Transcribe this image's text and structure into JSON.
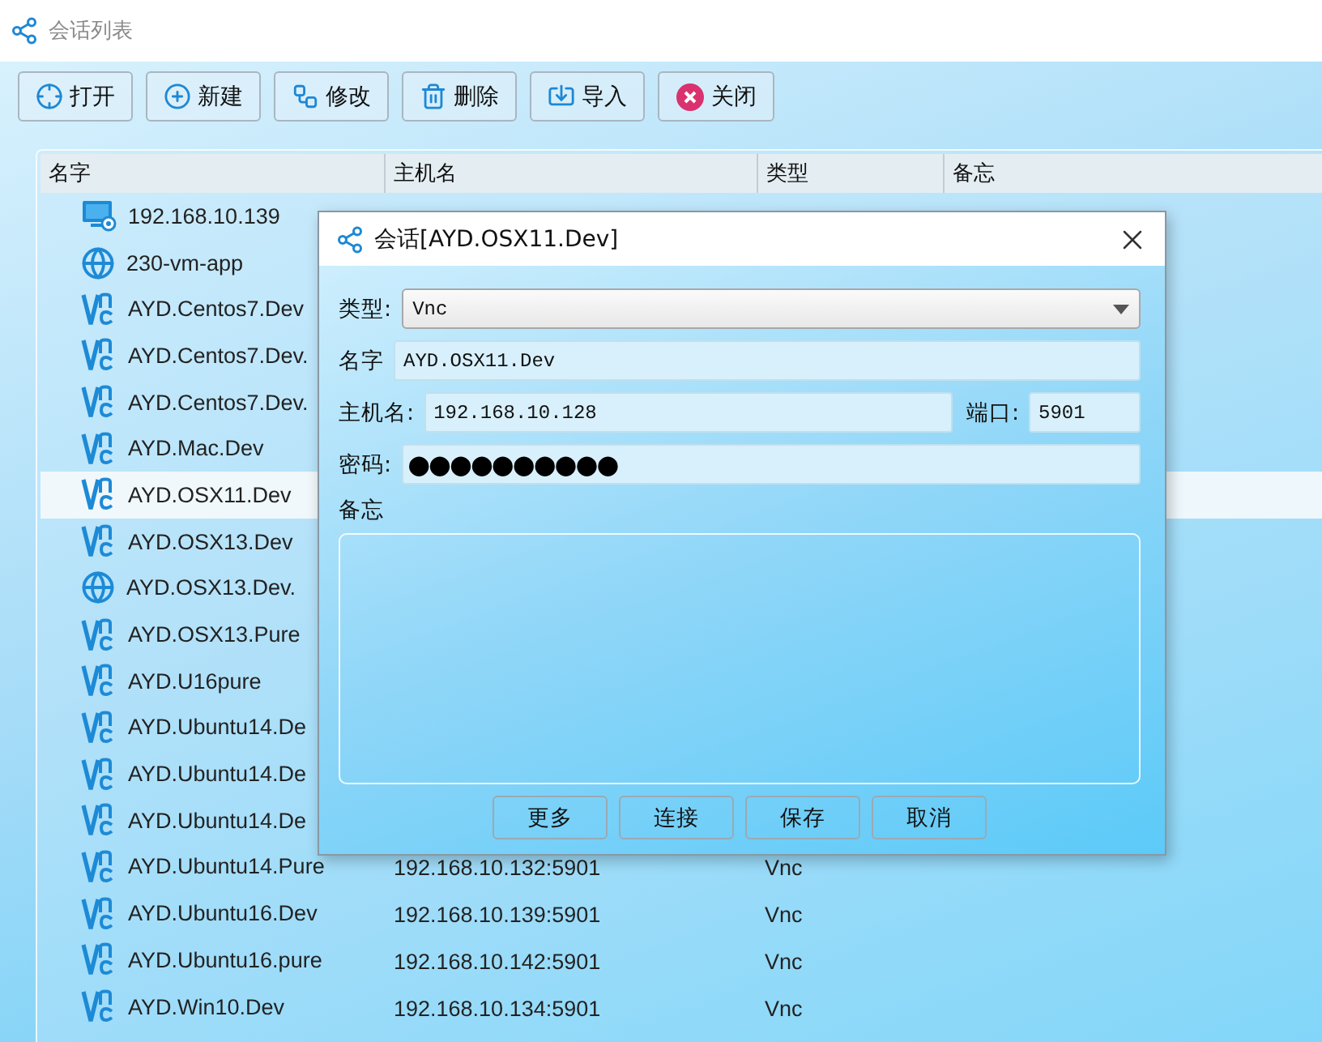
{
  "window": {
    "title": "会话列表"
  },
  "toolbar": [
    {
      "kind": "open",
      "label": "打开"
    },
    {
      "kind": "new",
      "label": "新建"
    },
    {
      "kind": "edit",
      "label": "修改"
    },
    {
      "kind": "delete",
      "label": "删除"
    },
    {
      "kind": "import",
      "label": "导入"
    },
    {
      "kind": "close",
      "label": "关闭"
    }
  ],
  "table": {
    "columns": [
      "名字",
      "主机名",
      "类型",
      "备忘"
    ],
    "rows": [
      {
        "kind": "monitor",
        "name": "192.168.10.139",
        "selected": false
      },
      {
        "kind": "globe",
        "name": "230-vm-app",
        "selected": false
      },
      {
        "kind": "vnc",
        "name": "AYD.Centos7.Dev",
        "selected": false
      },
      {
        "kind": "vnc",
        "name": "AYD.Centos7.Dev.",
        "selected": false
      },
      {
        "kind": "vnc",
        "name": "AYD.Centos7.Dev.",
        "selected": false
      },
      {
        "kind": "vnc",
        "name": "AYD.Mac.Dev",
        "selected": false
      },
      {
        "kind": "vnc",
        "name": "AYD.OSX11.Dev",
        "selected": true
      },
      {
        "kind": "vnc",
        "name": "AYD.OSX13.Dev",
        "selected": false
      },
      {
        "kind": "globe",
        "name": "AYD.OSX13.Dev.",
        "selected": false
      },
      {
        "kind": "vnc",
        "name": "AYD.OSX13.Pure",
        "selected": false
      },
      {
        "kind": "vnc",
        "name": "AYD.U16pure",
        "selected": false
      },
      {
        "kind": "vnc",
        "name": "AYD.Ubuntu14.De",
        "selected": false
      },
      {
        "kind": "vnc",
        "name": "AYD.Ubuntu14.De",
        "selected": false
      },
      {
        "kind": "vnc",
        "name": "AYD.Ubuntu14.De",
        "selected": false
      },
      {
        "kind": "vnc",
        "name": "AYD.Ubuntu14.Pure",
        "host": "192.168.10.132:5901",
        "type": "Vnc",
        "selected": false
      },
      {
        "kind": "vnc",
        "name": "AYD.Ubuntu16.Dev",
        "host": "192.168.10.139:5901",
        "type": "Vnc",
        "selected": false
      },
      {
        "kind": "vnc",
        "name": "AYD.Ubuntu16.pure",
        "host": "192.168.10.142:5901",
        "type": "Vnc",
        "selected": false
      },
      {
        "kind": "vnc",
        "name": "AYD.Win10.Dev",
        "host": "192.168.10.134:5901",
        "type": "Vnc",
        "selected": false
      }
    ]
  },
  "dialog": {
    "title": "会话[AYD.OSX11.Dev]",
    "type": {
      "label": "类型:",
      "value": "Vnc"
    },
    "name": {
      "label": "名字",
      "value": "AYD.OSX11.Dev"
    },
    "host": {
      "label": "主机名:",
      "value": "192.168.10.128"
    },
    "port": {
      "label": "端口:",
      "value": "5901"
    },
    "password": {
      "label": "密码:",
      "value": "●●●●●●●●●●"
    },
    "notes": {
      "label": "备忘"
    },
    "buttons": [
      "更多",
      "连接",
      "保存",
      "取消"
    ]
  }
}
